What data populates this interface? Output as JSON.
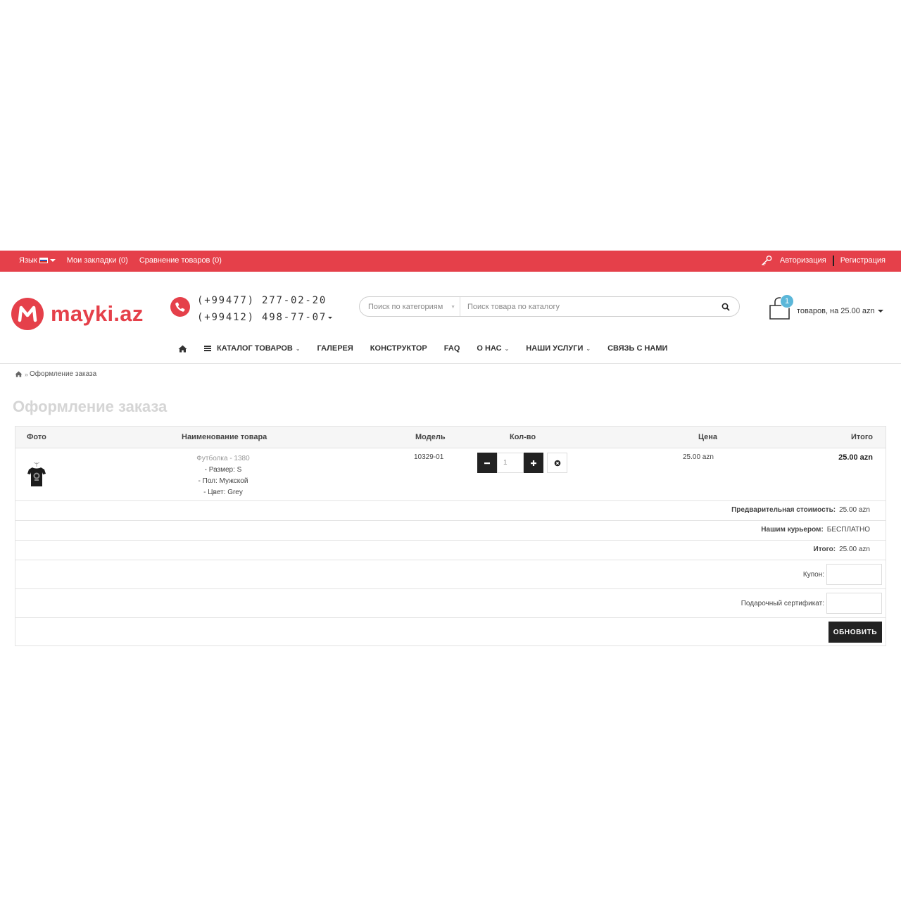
{
  "topbar": {
    "language_label": "Язык",
    "bookmarks": "Мои закладки (0)",
    "compare": "Сравнение товаров (0)",
    "login": "Авторизация",
    "register": "Регистрация"
  },
  "header": {
    "logo_text": "mayki.az",
    "phone_1": "(+99477) 277-02-20",
    "phone_2": "(+99412) 498-77-07",
    "search": {
      "category_placeholder": "Поиск по категориям",
      "query_placeholder": "Поиск товара по каталогу"
    },
    "cart": {
      "count": "1",
      "summary": "товаров, на 25.00 azn"
    }
  },
  "nav": {
    "catalog": "КАТАЛОГ ТОВАРОВ",
    "gallery": "ГАЛЕРЕЯ",
    "constructor": "КОНСТРУКТОР",
    "faq": "FAQ",
    "about": "О НАС",
    "services": "НАШИ УСЛУГИ",
    "contact": "СВЯЗЬ С НАМИ"
  },
  "breadcrumb": {
    "current": "Оформление заказа"
  },
  "page_title": "Оформление заказа",
  "cart_table": {
    "headers": {
      "photo": "Фото",
      "name": "Наименование товара",
      "model": "Модель",
      "qty": "Кол-во",
      "price": "Цена",
      "total": "Итого"
    },
    "item": {
      "name": "Футболка - 1380",
      "option_size": "- Размер: S",
      "option_gender": "- Пол: Мужской",
      "option_color": "- Цвет: Grey",
      "model": "10329-01",
      "quantity": "1",
      "price": "25.00 azn",
      "total": "25.00 azn"
    },
    "summary": {
      "subtotal_label": "Предварительная стоимость:",
      "subtotal_value": "25.00 azn",
      "shipping_label": "Нашим курьером:",
      "shipping_value": "БЕСПЛАТНО",
      "total_label": "Итого:",
      "total_value": "25.00 azn"
    },
    "coupon_label": "Купон:",
    "certificate_label": "Подарочный сертификат:",
    "update_button": "ОБНОВИТЬ"
  },
  "colors": {
    "brand": "#e5404a",
    "badge": "#5bb7d9",
    "dark_button": "#222222"
  }
}
